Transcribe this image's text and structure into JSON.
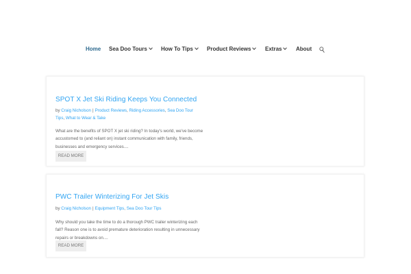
{
  "nav": {
    "items": [
      {
        "label": "Home",
        "dropdown": false,
        "active": true
      },
      {
        "label": "Sea Doo Tours",
        "dropdown": true,
        "active": false
      },
      {
        "label": "How To Tips",
        "dropdown": true,
        "active": false
      },
      {
        "label": "Product Reviews",
        "dropdown": true,
        "active": false
      },
      {
        "label": "Extras",
        "dropdown": true,
        "active": false
      },
      {
        "label": "About",
        "dropdown": false,
        "active": false
      }
    ],
    "search_icon": "search-icon"
  },
  "posts": [
    {
      "title": "SPOT X Jet Ski Riding Keeps You Connected",
      "by": "by",
      "author": "Craig Nicholson",
      "categories": [
        "Product Reviews",
        "Riding Accessories",
        "Sea Doo Tour Tips",
        "What to Wear & Take"
      ],
      "excerpt": "What are the benefits of SPOT X jet ski riding? In today's world, we've become accustomed to (and reliant on) instant communication with family, friends, businesses and emergency services....",
      "read_more": "READ MORE"
    },
    {
      "title": "PWC Trailer Winterizing For Jet Skis",
      "by": "by",
      "author": "Craig Nicholson",
      "categories": [
        "Equipment Tips",
        "Sea Doo Tour Tips"
      ],
      "excerpt": "Why should you take the time to do a thorough PWC trailer winterizing each fall? Reason one is to avoid premature deterioration resulting in unnecessary repairs or breakdowns on....",
      "read_more": "READ MORE"
    }
  ],
  "colors": {
    "accent": "#2ea3f2",
    "nav_active": "#2e6a8f",
    "text": "#666666"
  }
}
